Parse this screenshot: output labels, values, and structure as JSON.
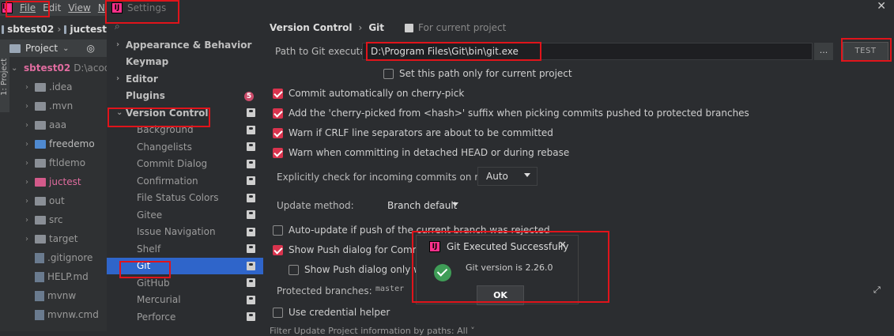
{
  "ide": {
    "menu": [
      "File",
      "Edit",
      "View",
      "N"
    ],
    "logo": "IJ",
    "crumbs": [
      "sbtest02",
      "juctest"
    ],
    "project_label": "Project",
    "side_tab": "1: Project",
    "root": {
      "name": "sbtest02",
      "path": "D:\\acod"
    },
    "tree": [
      {
        "label": ".idea",
        "kind": "folder"
      },
      {
        "label": ".mvn",
        "kind": "folder"
      },
      {
        "label": "aaa",
        "kind": "folder"
      },
      {
        "label": "freedemo",
        "kind": "folder-blue"
      },
      {
        "label": "ftldemo",
        "kind": "folder"
      },
      {
        "label": "juctest",
        "kind": "folder-pink"
      },
      {
        "label": "out",
        "kind": "folder"
      },
      {
        "label": "src",
        "kind": "folder"
      },
      {
        "label": "target",
        "kind": "folder"
      },
      {
        "label": ".gitignore",
        "kind": "file"
      },
      {
        "label": "HELP.md",
        "kind": "file"
      },
      {
        "label": "mvnw",
        "kind": "file"
      },
      {
        "label": "mvnw.cmd",
        "kind": "file"
      }
    ]
  },
  "dialog": {
    "title": "Settings",
    "close": "✕",
    "nav": [
      {
        "label": "Appearance & Behavior",
        "level": 0,
        "arrow": "›"
      },
      {
        "label": "Keymap",
        "level": 0,
        "arrow": ""
      },
      {
        "label": "Editor",
        "level": 0,
        "arrow": "›"
      },
      {
        "label": "Plugins",
        "level": 0,
        "arrow": "",
        "badge": "5"
      },
      {
        "label": "Version Control",
        "level": 0,
        "arrow": "⌄",
        "proj": true
      },
      {
        "label": "Background",
        "level": 1,
        "proj": true
      },
      {
        "label": "Changelists",
        "level": 1,
        "proj": true
      },
      {
        "label": "Commit Dialog",
        "level": 1,
        "proj": true
      },
      {
        "label": "Confirmation",
        "level": 1,
        "proj": true
      },
      {
        "label": "File Status Colors",
        "level": 1,
        "proj": true
      },
      {
        "label": "Gitee",
        "level": 1,
        "proj": true
      },
      {
        "label": "Issue Navigation",
        "level": 1,
        "proj": true
      },
      {
        "label": "Shelf",
        "level": 1,
        "proj": true
      },
      {
        "label": "Git",
        "level": 1,
        "proj": true,
        "selected": true
      },
      {
        "label": "GitHub",
        "level": 1,
        "proj": true
      },
      {
        "label": "Mercurial",
        "level": 1,
        "proj": true
      },
      {
        "label": "Perforce",
        "level": 1,
        "proj": true
      }
    ],
    "breadcrumb": {
      "a": "Version Control",
      "sep": "›",
      "b": "Git",
      "scope": "For current project"
    },
    "path_label": "Path to Git executable:",
    "path_value": "D:\\Program Files\\Git\\bin\\git.exe",
    "dots": "...",
    "test": "TEST",
    "set_path_only": "Set this path only for current project",
    "checks": [
      {
        "label": "Commit automatically on cherry-pick",
        "on": true
      },
      {
        "label": "Add the 'cherry-picked from <hash>' suffix when picking commits pushed to protected branches",
        "on": true
      },
      {
        "label": "Warn if CRLF line separators are about to be committed",
        "on": true
      },
      {
        "label": "Warn when committing in detached HEAD or during rebase",
        "on": true
      }
    ],
    "incoming_label": "Explicitly check for incoming commits on remotes:",
    "incoming_value": "Auto",
    "update_label": "Update method:",
    "update_value": "Branch default",
    "autoupdate": "Auto-update if push of the current branch was rejected",
    "showpush": "Show Push dialog for Commit and",
    "showpush_only": "Show Push dialog only when c",
    "protected_label": "Protected branches:",
    "protected_value": "master",
    "credential": "Use credential helper",
    "bottom": "Filter Update Project information by paths:   All ˅"
  },
  "popup": {
    "title": "Git Executed Successfully",
    "message": "Git version is 2.26.0",
    "ok": "OK",
    "close": "✕"
  }
}
